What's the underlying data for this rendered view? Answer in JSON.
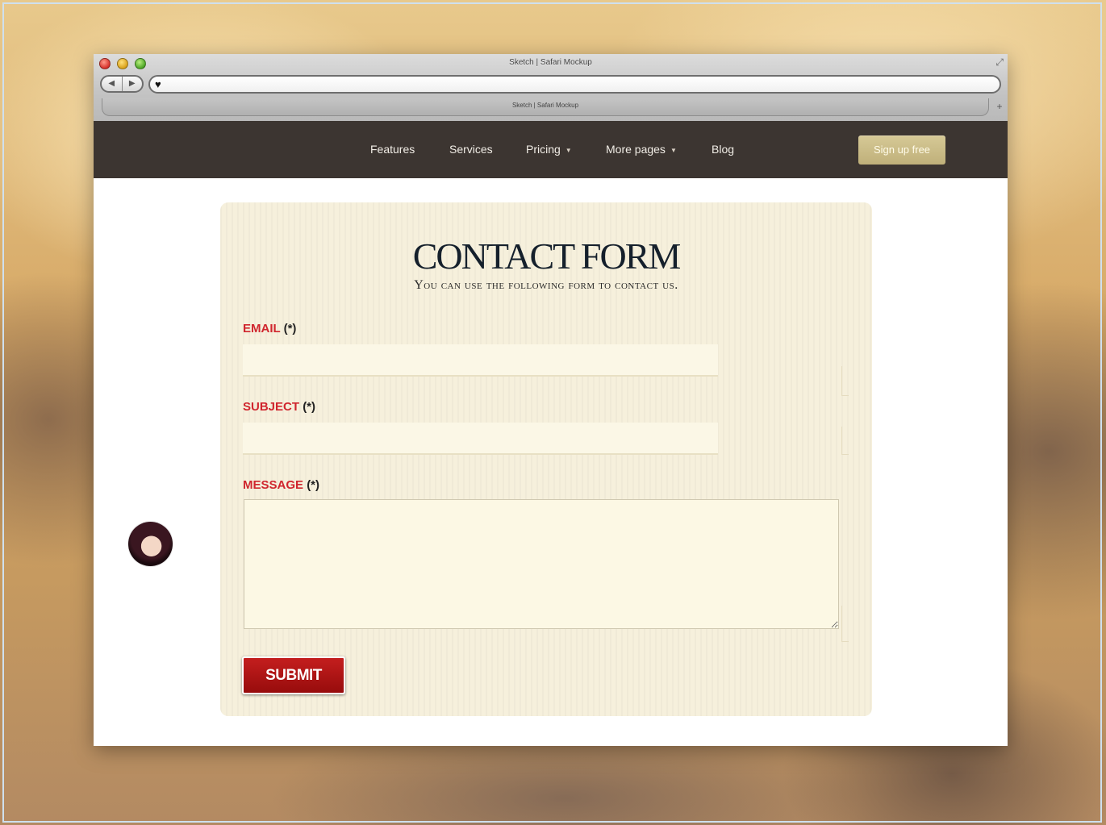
{
  "browser": {
    "window_title": "Sketch | Safari Mockup",
    "tab_title": "Sketch | Safari Mockup",
    "back_icon": "◀",
    "forward_icon": "▶",
    "new_tab_icon": "+",
    "resize_icon": "⤢",
    "url_icon": "♥",
    "url": ""
  },
  "nav": {
    "links": [
      {
        "label": "Features"
      },
      {
        "label": "Services"
      },
      {
        "label": "Pricing"
      },
      {
        "label": "More pages"
      },
      {
        "label": "Blog"
      }
    ],
    "caret": "▼",
    "signup_label": "Sign up free"
  },
  "form": {
    "title": "CONTACT FORM",
    "subtitle": "You can use the following form to contact us.",
    "email_label": "EMAIL",
    "subject_label": "SUBJECT",
    "message_label": "MESSAGE",
    "required_marker": "(*)",
    "email_value": "",
    "subject_value": "",
    "message_value": "",
    "submit_label": "SUBMIT"
  },
  "colors": {
    "nav_bg": "#3c3531",
    "signup_bg": "#cbbd86",
    "label_red": "#d0262e",
    "submit_red": "#b01414",
    "panel_bg": "#f6f0dc"
  }
}
